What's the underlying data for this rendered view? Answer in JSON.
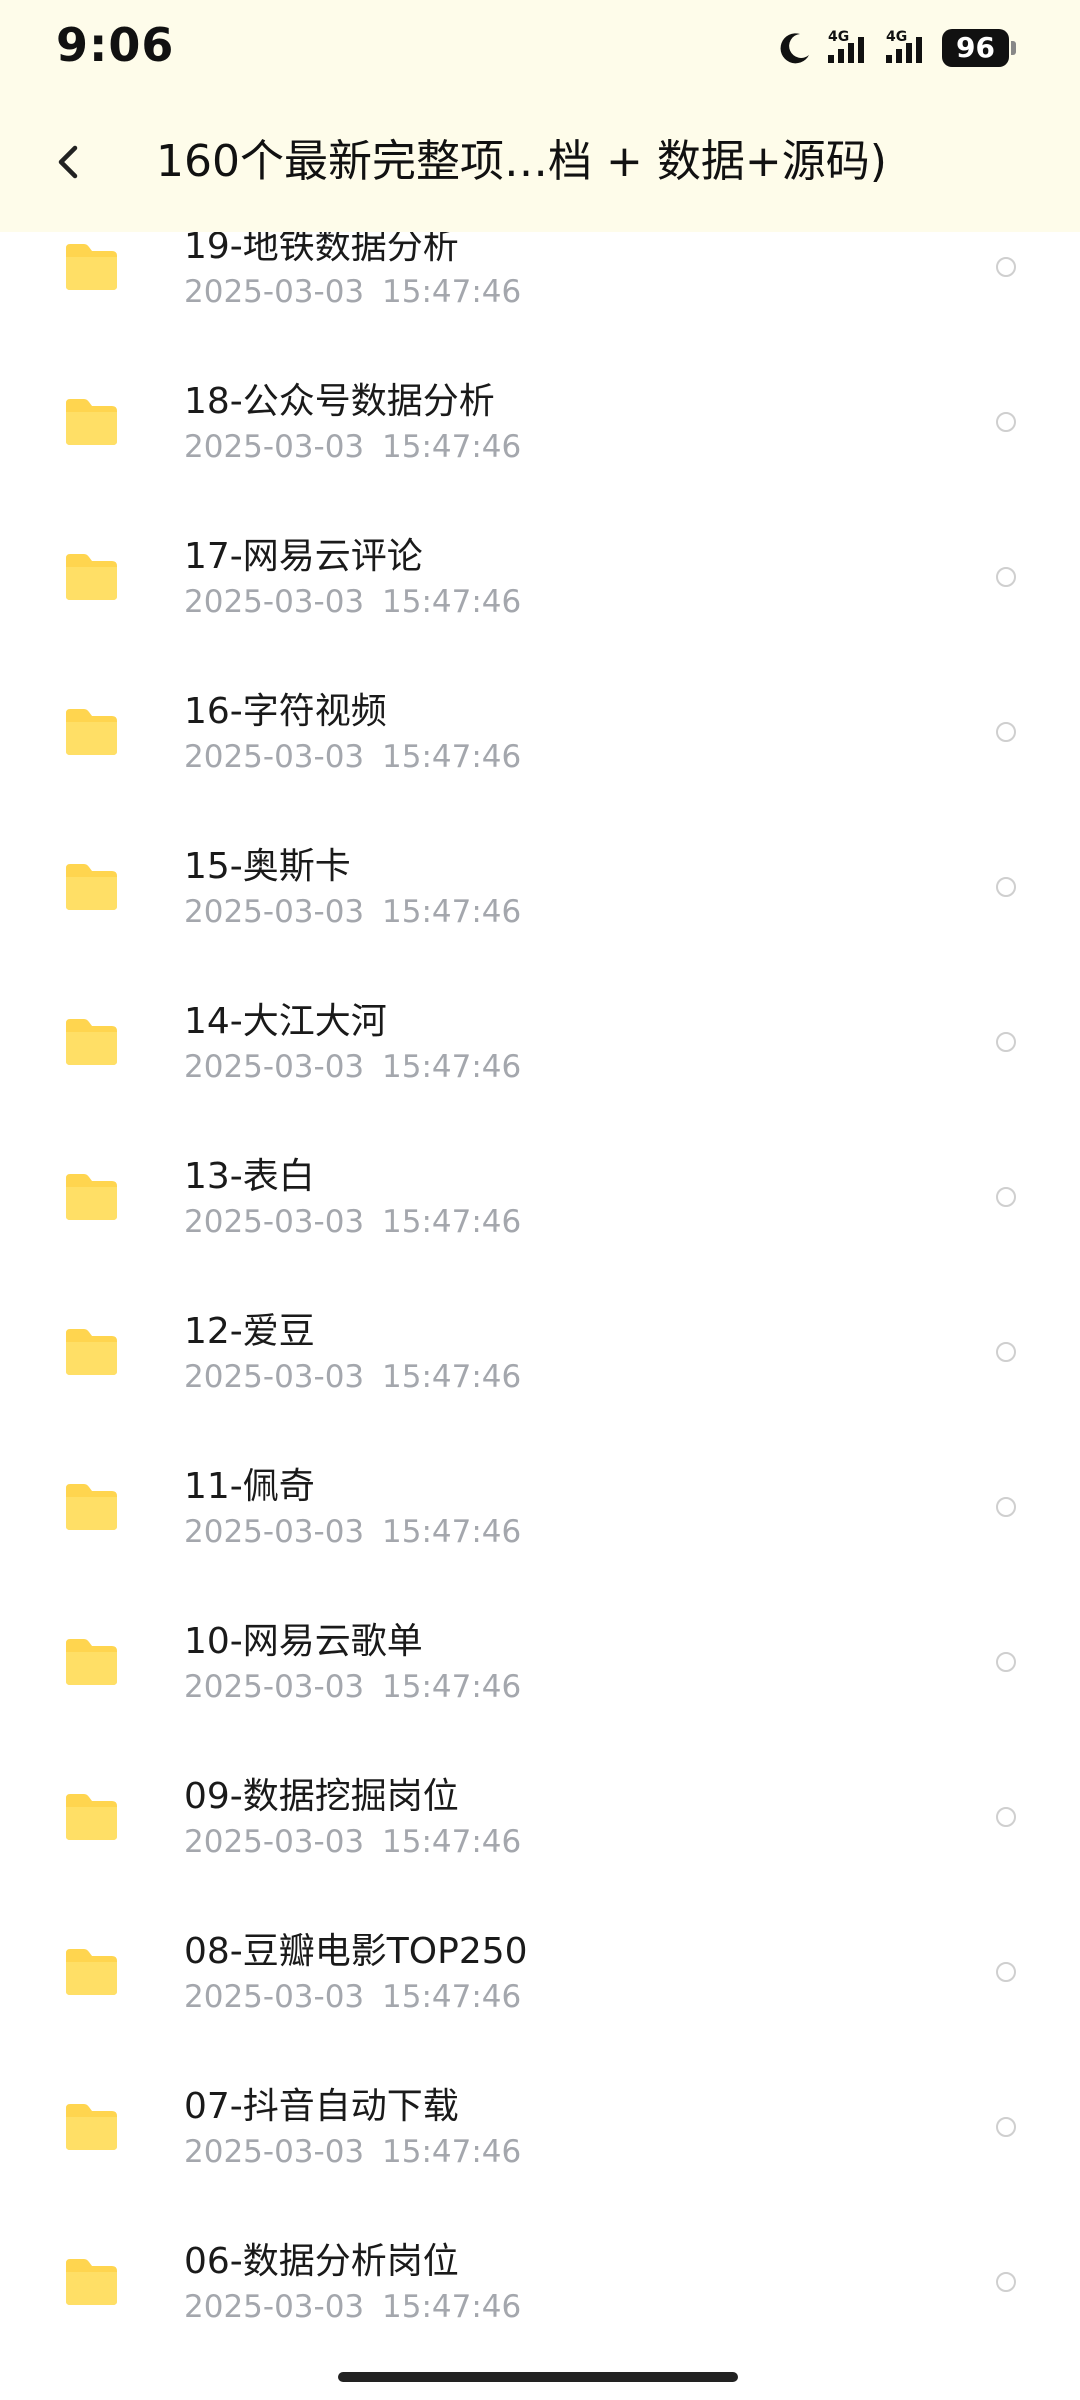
{
  "status_bar": {
    "time": "9:06",
    "signal1_label": "4G",
    "signal2_label": "4G",
    "battery": "96",
    "icons": [
      "moon-icon",
      "signal-icon",
      "signal-icon",
      "battery-icon"
    ]
  },
  "header": {
    "title": "160个最新完整项…档 + 数据+源码)",
    "back_icon": "chevron-left-icon",
    "background": "#fefcea"
  },
  "colors": {
    "folder": "#ffd54f",
    "date_text": "#a4a7ad",
    "radio_border": "#cfcfcf"
  },
  "files": [
    {
      "name": "19-地铁数据分析",
      "date": "2025-03-03  15:47:46"
    },
    {
      "name": "18-公众号数据分析",
      "date": "2025-03-03  15:47:46"
    },
    {
      "name": "17-网易云评论",
      "date": "2025-03-03  15:47:46"
    },
    {
      "name": "16-字符视频",
      "date": "2025-03-03  15:47:46"
    },
    {
      "name": "15-奥斯卡",
      "date": "2025-03-03  15:47:46"
    },
    {
      "name": "14-大江大河",
      "date": "2025-03-03  15:47:46"
    },
    {
      "name": "13-表白",
      "date": "2025-03-03  15:47:46"
    },
    {
      "name": "12-爱豆",
      "date": "2025-03-03  15:47:46"
    },
    {
      "name": "11-佩奇",
      "date": "2025-03-03  15:47:46"
    },
    {
      "name": "10-网易云歌单",
      "date": "2025-03-03  15:47:46"
    },
    {
      "name": "09-数据挖掘岗位",
      "date": "2025-03-03  15:47:46"
    },
    {
      "name": "08-豆瓣电影TOP250",
      "date": "2025-03-03  15:47:46"
    },
    {
      "name": "07-抖音自动下载",
      "date": "2025-03-03  15:47:46"
    },
    {
      "name": "06-数据分析岗位",
      "date": "2025-03-03  15:47:46"
    }
  ]
}
